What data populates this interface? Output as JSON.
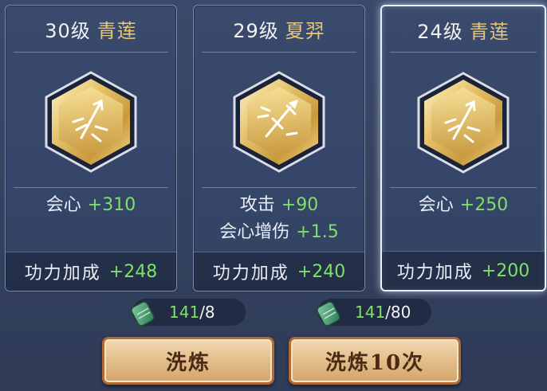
{
  "cards": [
    {
      "level": "30级",
      "class": "青莲",
      "stats": [
        {
          "name": "会心",
          "value": "+310"
        }
      ],
      "bonus_label": "功力加成",
      "bonus_value": "+248"
    },
    {
      "level": "29级",
      "class": "夏羿",
      "stats": [
        {
          "name": "攻击",
          "value": "+90"
        },
        {
          "name": "会心增伤",
          "value": "+1.5"
        }
      ],
      "bonus_label": "功力加成",
      "bonus_value": "+240"
    },
    {
      "level": "24级",
      "class": "青莲",
      "stats": [
        {
          "name": "会心",
          "value": "+250"
        }
      ],
      "bonus_label": "功力加成",
      "bonus_value": "+200"
    }
  ],
  "costs": [
    {
      "have": "141",
      "need": "/8"
    },
    {
      "have": "141",
      "need": "/80"
    }
  ],
  "buttons": {
    "refine": "洗炼",
    "refine10": "洗炼10次"
  },
  "icons": {
    "emblem_1": "arrow-emblem-icon",
    "emblem_2": "sword-emblem-icon",
    "emblem_3": "arrow-emblem-icon",
    "currency": "jade-stone-icon"
  },
  "colors": {
    "bonus_green": "#7ee06a",
    "class_gold": "#e7c77a",
    "button_border": "#b06a35"
  }
}
